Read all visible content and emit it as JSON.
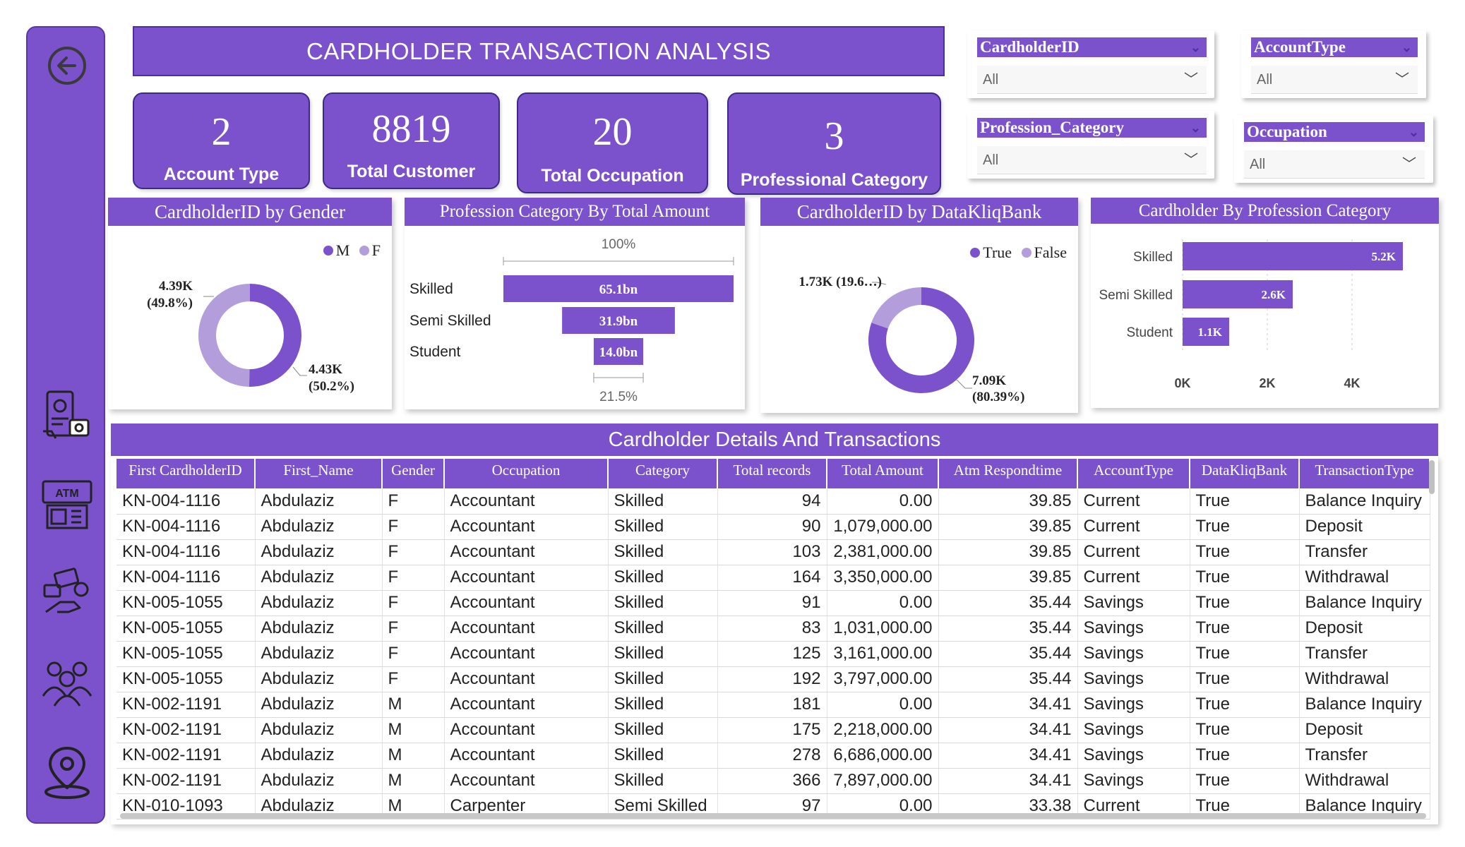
{
  "title": "CARDHOLDER TRANSACTION ANALYSIS",
  "sidebar": {
    "icons": [
      "back-arrow-icon",
      "payment-phone-icon",
      "atm-icon",
      "money-hand-icon",
      "people-group-icon",
      "location-pin-icon"
    ]
  },
  "kpis": [
    {
      "value": "2",
      "label": "Account Type"
    },
    {
      "value": "8819",
      "label": "Total Customer"
    },
    {
      "value": "20",
      "label": "Total Occupation"
    },
    {
      "value": "3",
      "label": "Professional Category"
    }
  ],
  "slicers": [
    {
      "title": "CardholderID",
      "value": "All"
    },
    {
      "title": "AccountType",
      "value": "All"
    },
    {
      "title": "Profession_Category",
      "value": "All"
    },
    {
      "title": "Occupation",
      "value": "All"
    }
  ],
  "colors": {
    "accent": "#7b52cc",
    "accent_light": "#b39ddb"
  },
  "chart_data": [
    {
      "type": "pie",
      "title": "CardholderID by Gender",
      "legend": [
        "M",
        "F"
      ],
      "slices": [
        {
          "name": "M",
          "value": 4430,
          "label": "4.43K",
          "pct": "(50.2%)"
        },
        {
          "name": "F",
          "value": 4390,
          "label": "4.39K",
          "pct": "(49.8%)"
        }
      ]
    },
    {
      "type": "bar",
      "title": "Profession Category By Total Amount",
      "categories": [
        "Skilled",
        "Semi Skilled",
        "Student"
      ],
      "values": [
        65.1,
        31.9,
        14.0
      ],
      "value_labels": [
        "65.1bn",
        "31.9bn",
        "14.0bn"
      ],
      "top_label": "100%",
      "bottom_label": "21.5%"
    },
    {
      "type": "pie",
      "title": "CardholderID by DataKliqBank",
      "legend": [
        "True",
        "False"
      ],
      "slices": [
        {
          "name": "True",
          "value": 7090,
          "label": "7.09K",
          "pct": "(80.39%)"
        },
        {
          "name": "False",
          "value": 1730,
          "label": "1.73K (19.6…)",
          "pct": ""
        }
      ]
    },
    {
      "type": "bar",
      "title": "Cardholder By Profession Category",
      "categories": [
        "Skilled",
        "Semi Skilled",
        "Student"
      ],
      "values": [
        5200,
        2600,
        1100
      ],
      "value_labels": [
        "5.2K",
        "2.6K",
        "1.1K"
      ],
      "xticks": [
        "0K",
        "2K",
        "4K"
      ],
      "xlim": [
        0,
        6000
      ]
    }
  ],
  "table": {
    "title": "Cardholder Details And Transactions",
    "columns": [
      "First CardholderID",
      "First_Name",
      "Gender",
      "Occupation",
      "Category",
      "Total records",
      "Total Amount",
      "Atm Respondtime",
      "AccountType",
      "DataKliqBank",
      "TransactionType"
    ],
    "rows": [
      [
        "KN-004-1116",
        "Abdulaziz",
        "F",
        "Accountant",
        "Skilled",
        "94",
        "0.00",
        "39.85",
        "Current",
        "True",
        "Balance Inquiry"
      ],
      [
        "KN-004-1116",
        "Abdulaziz",
        "F",
        "Accountant",
        "Skilled",
        "90",
        "1,079,000.00",
        "39.85",
        "Current",
        "True",
        "Deposit"
      ],
      [
        "KN-004-1116",
        "Abdulaziz",
        "F",
        "Accountant",
        "Skilled",
        "103",
        "2,381,000.00",
        "39.85",
        "Current",
        "True",
        "Transfer"
      ],
      [
        "KN-004-1116",
        "Abdulaziz",
        "F",
        "Accountant",
        "Skilled",
        "164",
        "3,350,000.00",
        "39.85",
        "Current",
        "True",
        "Withdrawal"
      ],
      [
        "KN-005-1055",
        "Abdulaziz",
        "F",
        "Accountant",
        "Skilled",
        "91",
        "0.00",
        "35.44",
        "Savings",
        "True",
        "Balance Inquiry"
      ],
      [
        "KN-005-1055",
        "Abdulaziz",
        "F",
        "Accountant",
        "Skilled",
        "83",
        "1,031,000.00",
        "35.44",
        "Savings",
        "True",
        "Deposit"
      ],
      [
        "KN-005-1055",
        "Abdulaziz",
        "F",
        "Accountant",
        "Skilled",
        "125",
        "3,161,000.00",
        "35.44",
        "Savings",
        "True",
        "Transfer"
      ],
      [
        "KN-005-1055",
        "Abdulaziz",
        "F",
        "Accountant",
        "Skilled",
        "192",
        "3,797,000.00",
        "35.44",
        "Savings",
        "True",
        "Withdrawal"
      ],
      [
        "KN-002-1191",
        "Abdulaziz",
        "M",
        "Accountant",
        "Skilled",
        "181",
        "0.00",
        "34.41",
        "Savings",
        "True",
        "Balance Inquiry"
      ],
      [
        "KN-002-1191",
        "Abdulaziz",
        "M",
        "Accountant",
        "Skilled",
        "175",
        "2,218,000.00",
        "34.41",
        "Savings",
        "True",
        "Deposit"
      ],
      [
        "KN-002-1191",
        "Abdulaziz",
        "M",
        "Accountant",
        "Skilled",
        "278",
        "6,686,000.00",
        "34.41",
        "Savings",
        "True",
        "Transfer"
      ],
      [
        "KN-002-1191",
        "Abdulaziz",
        "M",
        "Accountant",
        "Skilled",
        "366",
        "7,897,000.00",
        "34.41",
        "Savings",
        "True",
        "Withdrawal"
      ],
      [
        "KN-010-1093",
        "Abdulaziz",
        "M",
        "Carpenter",
        "Semi Skilled",
        "97",
        "0.00",
        "33.38",
        "Current",
        "True",
        "Balance Inquiry"
      ]
    ]
  }
}
